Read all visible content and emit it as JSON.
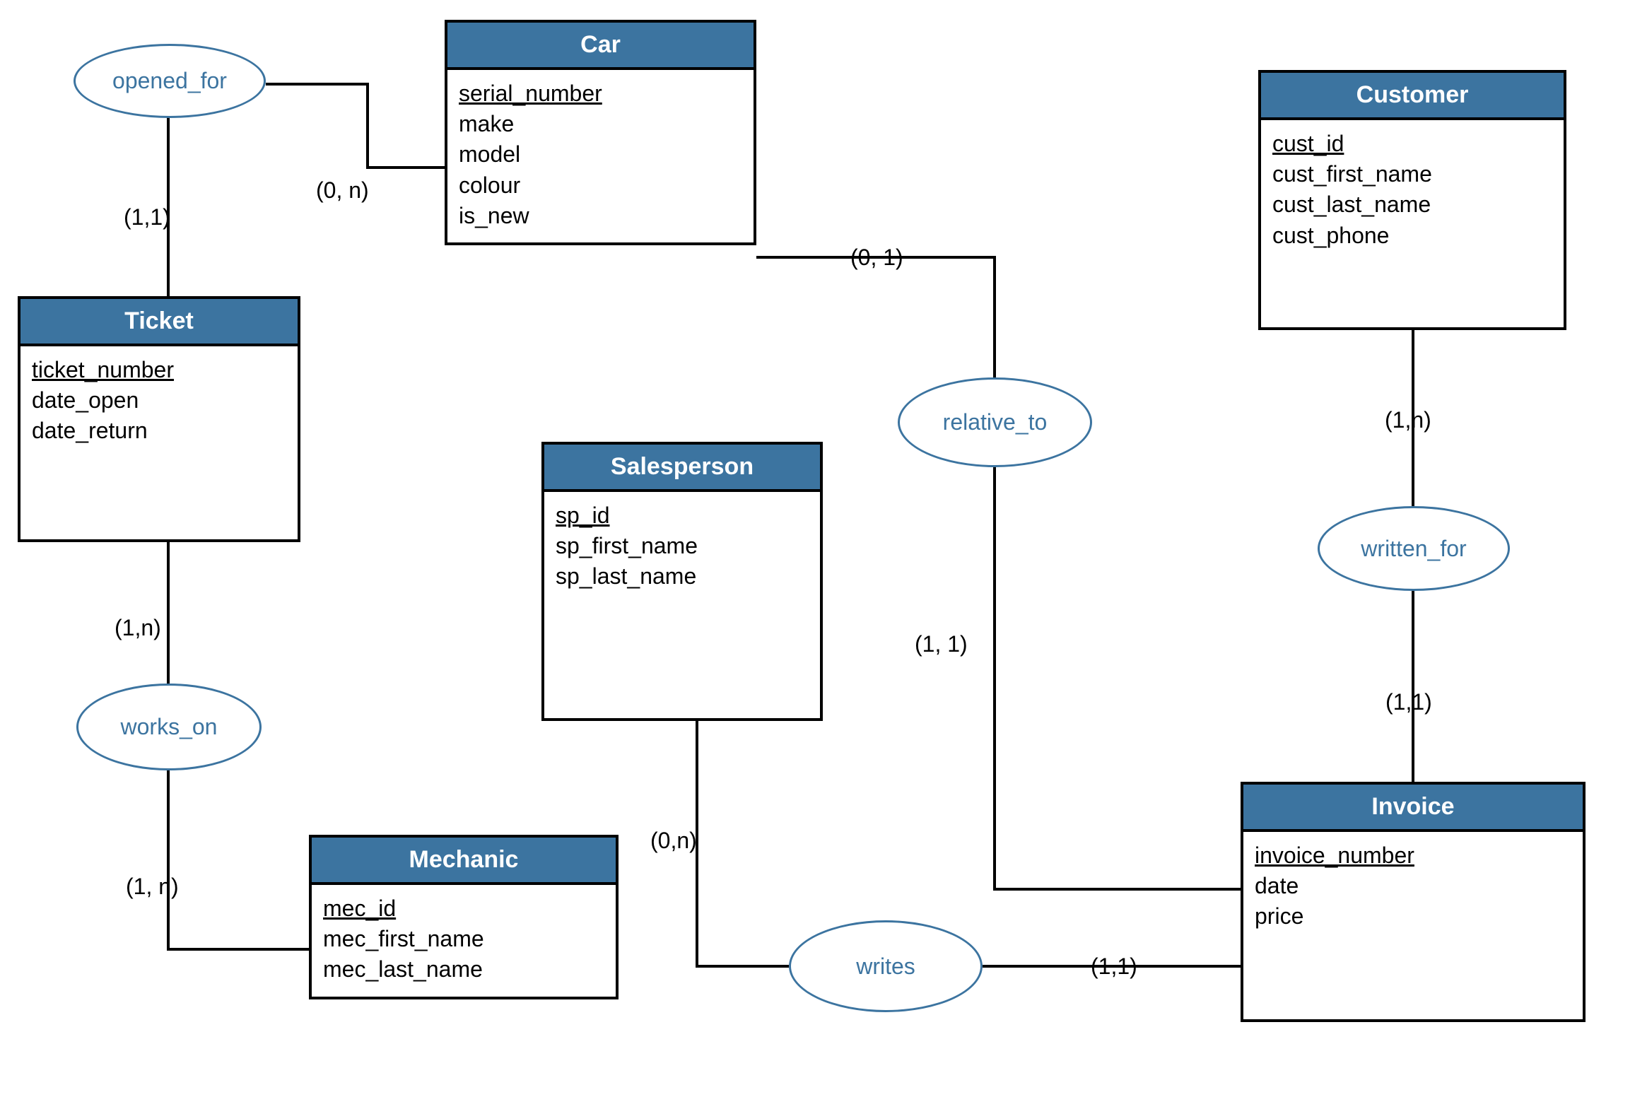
{
  "entities": {
    "car": {
      "title": "Car",
      "attrs": [
        "serial_number",
        "make",
        "model",
        "colour",
        "is_new"
      ]
    },
    "ticket": {
      "title": "Ticket",
      "attrs": [
        "ticket_number",
        "date_open",
        "date_return"
      ]
    },
    "customer": {
      "title": "Customer",
      "attrs": [
        "cust_id",
        "cust_first_name",
        "cust_last_name",
        "cust_phone"
      ]
    },
    "salesperson": {
      "title": "Salesperson",
      "attrs": [
        "sp_id",
        "sp_first_name",
        "sp_last_name"
      ]
    },
    "mechanic": {
      "title": "Mechanic",
      "attrs": [
        "mec_id",
        "mec_first_name",
        "mec_last_name"
      ]
    },
    "invoice": {
      "title": "Invoice",
      "attrs": [
        "invoice_number",
        "date",
        "price"
      ]
    }
  },
  "relationships": {
    "opened_for": "opened_for",
    "relative_to": "relative_to",
    "written_for": "written_for",
    "works_on": "works_on",
    "writes": "writes"
  },
  "cardinalities": {
    "opened_for_ticket": "(1,1)",
    "opened_for_car": "(0, n)",
    "relative_to_car": "(0, 1)",
    "relative_to_invoice": "(1, 1)",
    "written_for_customer": "(1,n)",
    "written_for_invoice": "(1,1)",
    "works_on_ticket": "(1,n)",
    "works_on_mechanic": "(1, n)",
    "writes_salesperson": "(0,n)",
    "writes_invoice": "(1,1)"
  }
}
